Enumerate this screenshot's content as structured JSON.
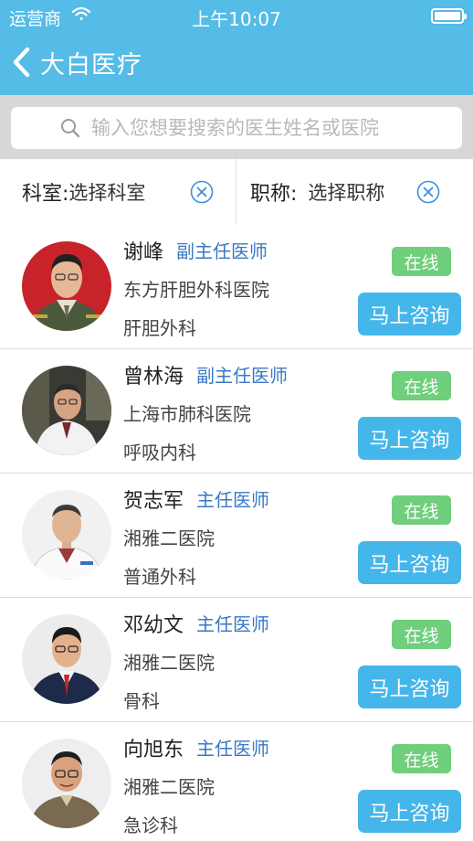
{
  "status_bar": {
    "carrier": "运营商",
    "time": "上午10:07"
  },
  "nav": {
    "title": "大白医疗"
  },
  "search": {
    "placeholder": "输入您想要搜索的医生姓名或医院"
  },
  "filters": {
    "department": {
      "label": "科室:",
      "value": "选择科室"
    },
    "title": {
      "label": "职称:",
      "value": "选择职称"
    }
  },
  "doctors": [
    {
      "name": "谢峰",
      "title": "副主任医师",
      "hospital": "东方肝胆外科医院",
      "department": "肝胆外科",
      "status": "在线",
      "action": "马上咨询",
      "avatar": "doctor-military-uniform-photo"
    },
    {
      "name": "曾林海",
      "title": "副主任医师",
      "hospital": "上海市肺科医院",
      "department": "呼吸内科",
      "status": "在线",
      "action": "马上咨询",
      "avatar": "doctor-white-coat-office-photo"
    },
    {
      "name": "贺志军",
      "title": "主任医师",
      "hospital": "湘雅二医院",
      "department": "普通外科",
      "status": "在线",
      "action": "马上咨询",
      "avatar": "doctor-white-coat-portrait"
    },
    {
      "name": "邓幼文",
      "title": "主任医师",
      "hospital": "湘雅二医院",
      "department": "骨科",
      "status": "在线",
      "action": "马上咨询",
      "avatar": "doctor-glasses-suit-portrait"
    },
    {
      "name": "向旭东",
      "title": "主任医师",
      "hospital": "湘雅二医院",
      "department": "急诊科",
      "status": "在线",
      "action": "马上咨询",
      "avatar": "doctor-glasses-casual-portrait"
    }
  ],
  "colors": {
    "header": "#55bbe7",
    "title_blue": "#3a78c5",
    "online_green": "#6fcf7c",
    "button_blue": "#45b6e9",
    "search_bg": "#d7d7d9"
  }
}
